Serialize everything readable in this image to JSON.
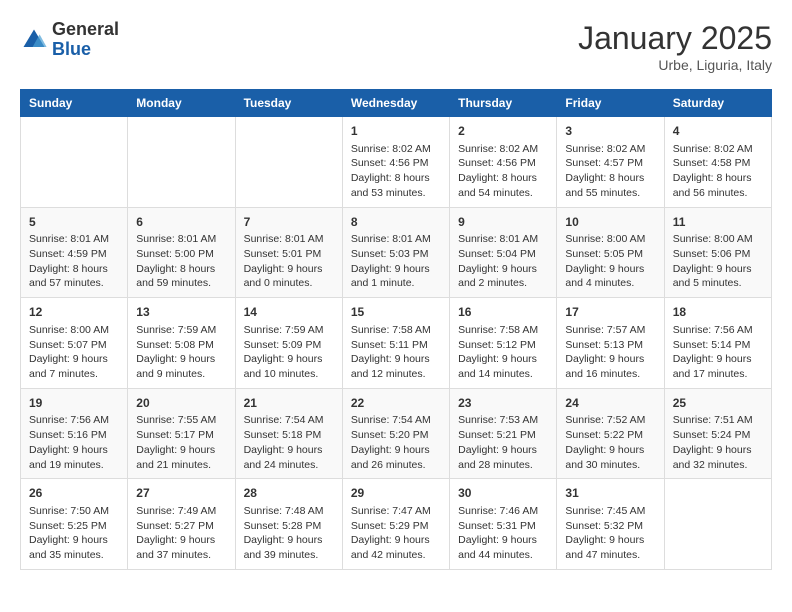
{
  "header": {
    "logo": {
      "general": "General",
      "blue": "Blue"
    },
    "title": "January 2025",
    "subtitle": "Urbe, Liguria, Italy"
  },
  "calendar": {
    "weekdays": [
      "Sunday",
      "Monday",
      "Tuesday",
      "Wednesday",
      "Thursday",
      "Friday",
      "Saturday"
    ],
    "weeks": [
      [
        {
          "day": "",
          "info": ""
        },
        {
          "day": "",
          "info": ""
        },
        {
          "day": "",
          "info": ""
        },
        {
          "day": "1",
          "info": "Sunrise: 8:02 AM\nSunset: 4:56 PM\nDaylight: 8 hours\nand 53 minutes."
        },
        {
          "day": "2",
          "info": "Sunrise: 8:02 AM\nSunset: 4:56 PM\nDaylight: 8 hours\nand 54 minutes."
        },
        {
          "day": "3",
          "info": "Sunrise: 8:02 AM\nSunset: 4:57 PM\nDaylight: 8 hours\nand 55 minutes."
        },
        {
          "day": "4",
          "info": "Sunrise: 8:02 AM\nSunset: 4:58 PM\nDaylight: 8 hours\nand 56 minutes."
        }
      ],
      [
        {
          "day": "5",
          "info": "Sunrise: 8:01 AM\nSunset: 4:59 PM\nDaylight: 8 hours\nand 57 minutes."
        },
        {
          "day": "6",
          "info": "Sunrise: 8:01 AM\nSunset: 5:00 PM\nDaylight: 8 hours\nand 59 minutes."
        },
        {
          "day": "7",
          "info": "Sunrise: 8:01 AM\nSunset: 5:01 PM\nDaylight: 9 hours\nand 0 minutes."
        },
        {
          "day": "8",
          "info": "Sunrise: 8:01 AM\nSunset: 5:03 PM\nDaylight: 9 hours\nand 1 minute."
        },
        {
          "day": "9",
          "info": "Sunrise: 8:01 AM\nSunset: 5:04 PM\nDaylight: 9 hours\nand 2 minutes."
        },
        {
          "day": "10",
          "info": "Sunrise: 8:00 AM\nSunset: 5:05 PM\nDaylight: 9 hours\nand 4 minutes."
        },
        {
          "day": "11",
          "info": "Sunrise: 8:00 AM\nSunset: 5:06 PM\nDaylight: 9 hours\nand 5 minutes."
        }
      ],
      [
        {
          "day": "12",
          "info": "Sunrise: 8:00 AM\nSunset: 5:07 PM\nDaylight: 9 hours\nand 7 minutes."
        },
        {
          "day": "13",
          "info": "Sunrise: 7:59 AM\nSunset: 5:08 PM\nDaylight: 9 hours\nand 9 minutes."
        },
        {
          "day": "14",
          "info": "Sunrise: 7:59 AM\nSunset: 5:09 PM\nDaylight: 9 hours\nand 10 minutes."
        },
        {
          "day": "15",
          "info": "Sunrise: 7:58 AM\nSunset: 5:11 PM\nDaylight: 9 hours\nand 12 minutes."
        },
        {
          "day": "16",
          "info": "Sunrise: 7:58 AM\nSunset: 5:12 PM\nDaylight: 9 hours\nand 14 minutes."
        },
        {
          "day": "17",
          "info": "Sunrise: 7:57 AM\nSunset: 5:13 PM\nDaylight: 9 hours\nand 16 minutes."
        },
        {
          "day": "18",
          "info": "Sunrise: 7:56 AM\nSunset: 5:14 PM\nDaylight: 9 hours\nand 17 minutes."
        }
      ],
      [
        {
          "day": "19",
          "info": "Sunrise: 7:56 AM\nSunset: 5:16 PM\nDaylight: 9 hours\nand 19 minutes."
        },
        {
          "day": "20",
          "info": "Sunrise: 7:55 AM\nSunset: 5:17 PM\nDaylight: 9 hours\nand 21 minutes."
        },
        {
          "day": "21",
          "info": "Sunrise: 7:54 AM\nSunset: 5:18 PM\nDaylight: 9 hours\nand 24 minutes."
        },
        {
          "day": "22",
          "info": "Sunrise: 7:54 AM\nSunset: 5:20 PM\nDaylight: 9 hours\nand 26 minutes."
        },
        {
          "day": "23",
          "info": "Sunrise: 7:53 AM\nSunset: 5:21 PM\nDaylight: 9 hours\nand 28 minutes."
        },
        {
          "day": "24",
          "info": "Sunrise: 7:52 AM\nSunset: 5:22 PM\nDaylight: 9 hours\nand 30 minutes."
        },
        {
          "day": "25",
          "info": "Sunrise: 7:51 AM\nSunset: 5:24 PM\nDaylight: 9 hours\nand 32 minutes."
        }
      ],
      [
        {
          "day": "26",
          "info": "Sunrise: 7:50 AM\nSunset: 5:25 PM\nDaylight: 9 hours\nand 35 minutes."
        },
        {
          "day": "27",
          "info": "Sunrise: 7:49 AM\nSunset: 5:27 PM\nDaylight: 9 hours\nand 37 minutes."
        },
        {
          "day": "28",
          "info": "Sunrise: 7:48 AM\nSunset: 5:28 PM\nDaylight: 9 hours\nand 39 minutes."
        },
        {
          "day": "29",
          "info": "Sunrise: 7:47 AM\nSunset: 5:29 PM\nDaylight: 9 hours\nand 42 minutes."
        },
        {
          "day": "30",
          "info": "Sunrise: 7:46 AM\nSunset: 5:31 PM\nDaylight: 9 hours\nand 44 minutes."
        },
        {
          "day": "31",
          "info": "Sunrise: 7:45 AM\nSunset: 5:32 PM\nDaylight: 9 hours\nand 47 minutes."
        },
        {
          "day": "",
          "info": ""
        }
      ]
    ]
  }
}
